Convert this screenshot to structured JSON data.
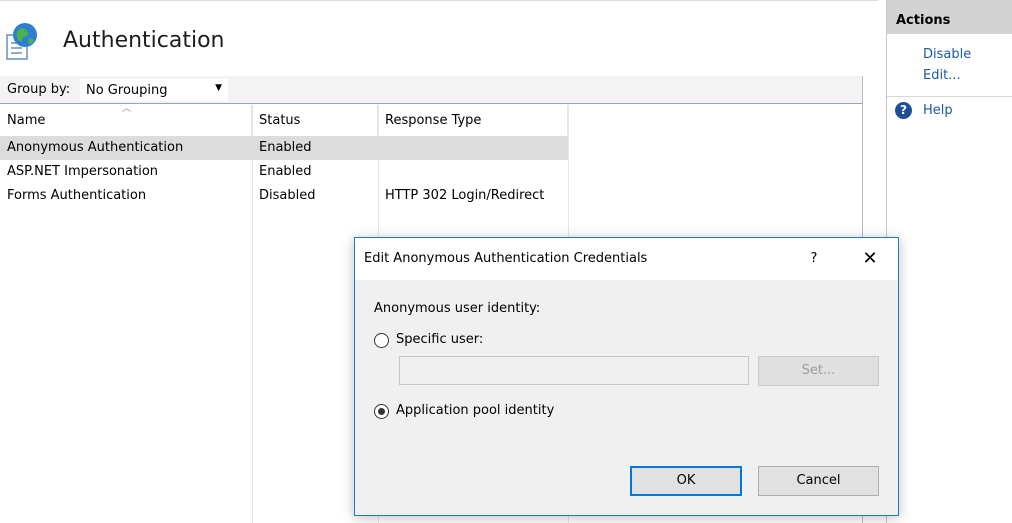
{
  "header": {
    "title": "Authentication",
    "icon": "globe-document-icon"
  },
  "toolbar": {
    "group_by_label": "Group by:",
    "group_by_value": "No Grouping"
  },
  "table": {
    "columns": [
      "Name",
      "Status",
      "Response Type"
    ],
    "rows": [
      {
        "name": "Anonymous Authentication",
        "status": "Enabled",
        "response_type": "",
        "selected": true
      },
      {
        "name": "ASP.NET Impersonation",
        "status": "Enabled",
        "response_type": "",
        "selected": false
      },
      {
        "name": "Forms Authentication",
        "status": "Disabled",
        "response_type": "HTTP 302 Login/Redirect",
        "selected": false
      }
    ]
  },
  "actions": {
    "title": "Actions",
    "disable": "Disable",
    "edit": "Edit...",
    "help": "Help"
  },
  "dialog": {
    "title": "Edit Anonymous Authentication Credentials",
    "help_button": "?",
    "close_button": "✕",
    "identity_label": "Anonymous user identity:",
    "specific_user_label": "Specific user:",
    "specific_user_value": "",
    "set_button": "Set...",
    "app_pool_label": "Application pool identity",
    "selected_option": "app_pool",
    "ok": "OK",
    "cancel": "Cancel"
  },
  "colors": {
    "accent": "#0078d7",
    "link": "#1a5aa6",
    "selected_row": "#dcdcdc",
    "actions_header": "#d3d3d3"
  }
}
